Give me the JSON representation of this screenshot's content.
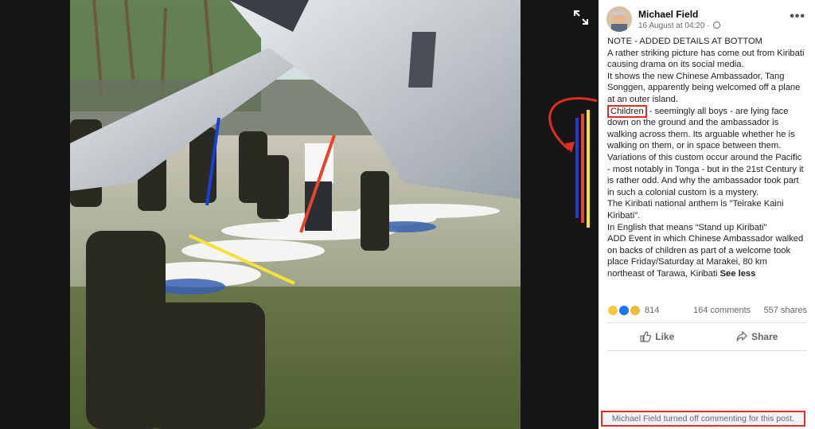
{
  "post": {
    "author": "Michael Field",
    "timestamp": "16 August at 04:20 · ",
    "more_label": "•••",
    "body": {
      "line1": "NOTE - ADDED DETAILS AT BOTTOM",
      "para1": "A rather striking picture has come out from Kiribati causing drama on its social media.",
      "para2": "It shows the new Chinese Ambassador, Tang Songgen, apparently being welcomed off a plane at an outer island.",
      "children_word": "Children",
      "para3_rest": " - seemingly all boys - are lying face down on the ground and the ambassador is walking across them. Its arguable whether he is walking on them, or in space between them. Variations of this custom occur around the Pacific - most notably in Tonga - but in the 21st Century it is rather odd. And why the ambassador took part in such a colonial custom is a mystery.",
      "para4": "The Kiribati national anthem is \"Teirake Kaini Kiribati\".",
      "para5": "In English that means “Stand up Kiribati\"",
      "para6": "ADD Event in which Chinese Ambassador walked on backs of children as part of a welcome took place Friday/Saturday at Marakei, 80 km northeast of Tarawa, Kiribati ",
      "see_less": "See less"
    },
    "reactions": {
      "count": "814",
      "comments": "164 comments",
      "shares": "557 shares",
      "icons": [
        "haha-icon",
        "like-icon",
        "sad-icon"
      ]
    },
    "actions": {
      "like": "Like",
      "share": "Share"
    },
    "commenting_notice": "Michael Field turned off commenting for this post."
  },
  "colors": {
    "annotation_red": "#e02f22",
    "annotation_blue": "#1b3fd6",
    "annotation_yellow": "#f4e23a",
    "annotation_orange_red": "#e8432b"
  }
}
